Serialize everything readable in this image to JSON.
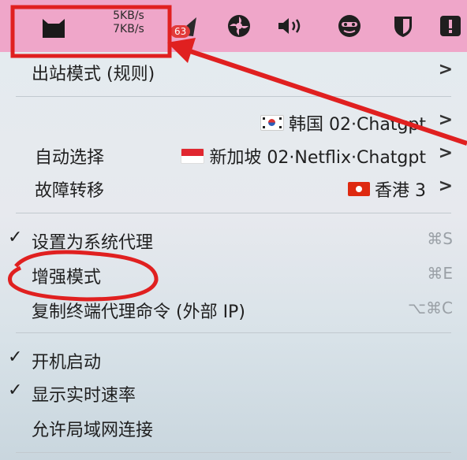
{
  "menubar": {
    "speed_up": "5KB/s",
    "speed_down": "7KB/s",
    "badge": "63",
    "icons": [
      "cat-icon",
      "airplane-icon",
      "fan-icon",
      "volume-icon",
      "mask-icon",
      "shield-icon",
      "alert-icon"
    ]
  },
  "menu": {
    "outbound_mode": "出站模式 (规则)",
    "proxy_rows": [
      {
        "label": "",
        "server": "韩国 02·Chatgpt",
        "flag": "korea"
      },
      {
        "label": "自动选择",
        "server": "新加坡 02·Netflix·Chatgpt",
        "flag": "singapore"
      },
      {
        "label": "故障转移",
        "server": "香港 3",
        "flag": "hongkong"
      }
    ],
    "set_system_proxy": "设置为系统代理",
    "set_system_proxy_shortcut": "⌘S",
    "enhanced_mode": "增强模式",
    "enhanced_mode_shortcut": "⌘E",
    "copy_terminal": "复制终端代理命令 (外部 IP)",
    "copy_terminal_shortcut": "⌥⌘C",
    "launch_at_login": "开机启动",
    "show_speed": "显示实时速率",
    "allow_lan": "允许局域网连接",
    "check_mark": "✓",
    "submenu_arrow": ">"
  },
  "colors": {
    "menubar_bg": "#efa6c9",
    "annotation_red": "#e02020"
  }
}
